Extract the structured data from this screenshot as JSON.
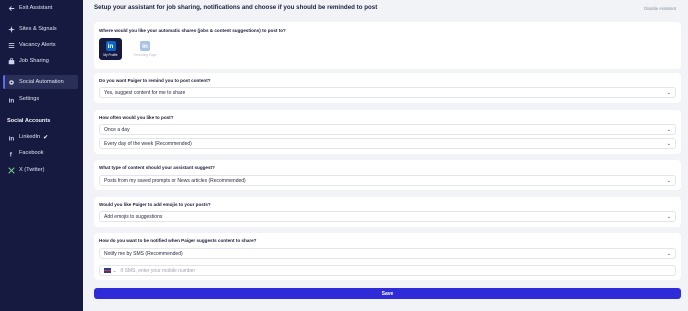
{
  "sidebar": {
    "items": [
      {
        "label": "Exit Assistant",
        "icon": "arrow-left-icon"
      },
      {
        "label": "Sites & Signals",
        "icon": "sparkle-icon"
      },
      {
        "label": "Vacancy Alerts",
        "icon": "list-icon"
      },
      {
        "label": "Job Sharing",
        "icon": "briefcase-icon"
      },
      {
        "label": "Social Automation",
        "icon": "gear-icon"
      },
      {
        "label": "Settings",
        "icon": "linkedin-icon"
      }
    ],
    "social_title": "Social Accounts",
    "accounts": [
      {
        "label": "LinkedIn",
        "check": "✔"
      },
      {
        "label": "Facebook"
      },
      {
        "label": "X (Twitter)"
      }
    ]
  },
  "header": {
    "title": "Setup your assistant for job sharing, notifications and choose if you should be reminded to post",
    "disable_label": "Disable Assistant"
  },
  "q1": {
    "question": "Where would you like your automatic shares (jobs & content suggestions) to post to?",
    "option1": "My Profile",
    "option2": "Recruiting Page"
  },
  "q2": {
    "question": "Do you want Paiger to remind you to post content?",
    "value": "Yes, suggest content for me to share"
  },
  "q3": {
    "question": "How often would you like to post?",
    "value1": "Once a day",
    "value2": "Every day of the week (Recommended)"
  },
  "q4": {
    "question": "What type of content should your assistant suggest?",
    "value": "Posts from my saved prompts or News articles (Recommended)"
  },
  "q5": {
    "question": "Would you like Paiger to add emojis to your posts?",
    "value": "Add emojis to suggestions"
  },
  "q6": {
    "question": "How do you want to be notified when Paiger suggests content to share?",
    "value": "Notify me by SMS (Recommended)",
    "phone_placeholder": "If SMS, enter your mobile number"
  },
  "save_label": "Save",
  "colors": {
    "sidebar": "#161a40",
    "accent": "#2f2bd8",
    "linkedin": "#0a66c2"
  }
}
